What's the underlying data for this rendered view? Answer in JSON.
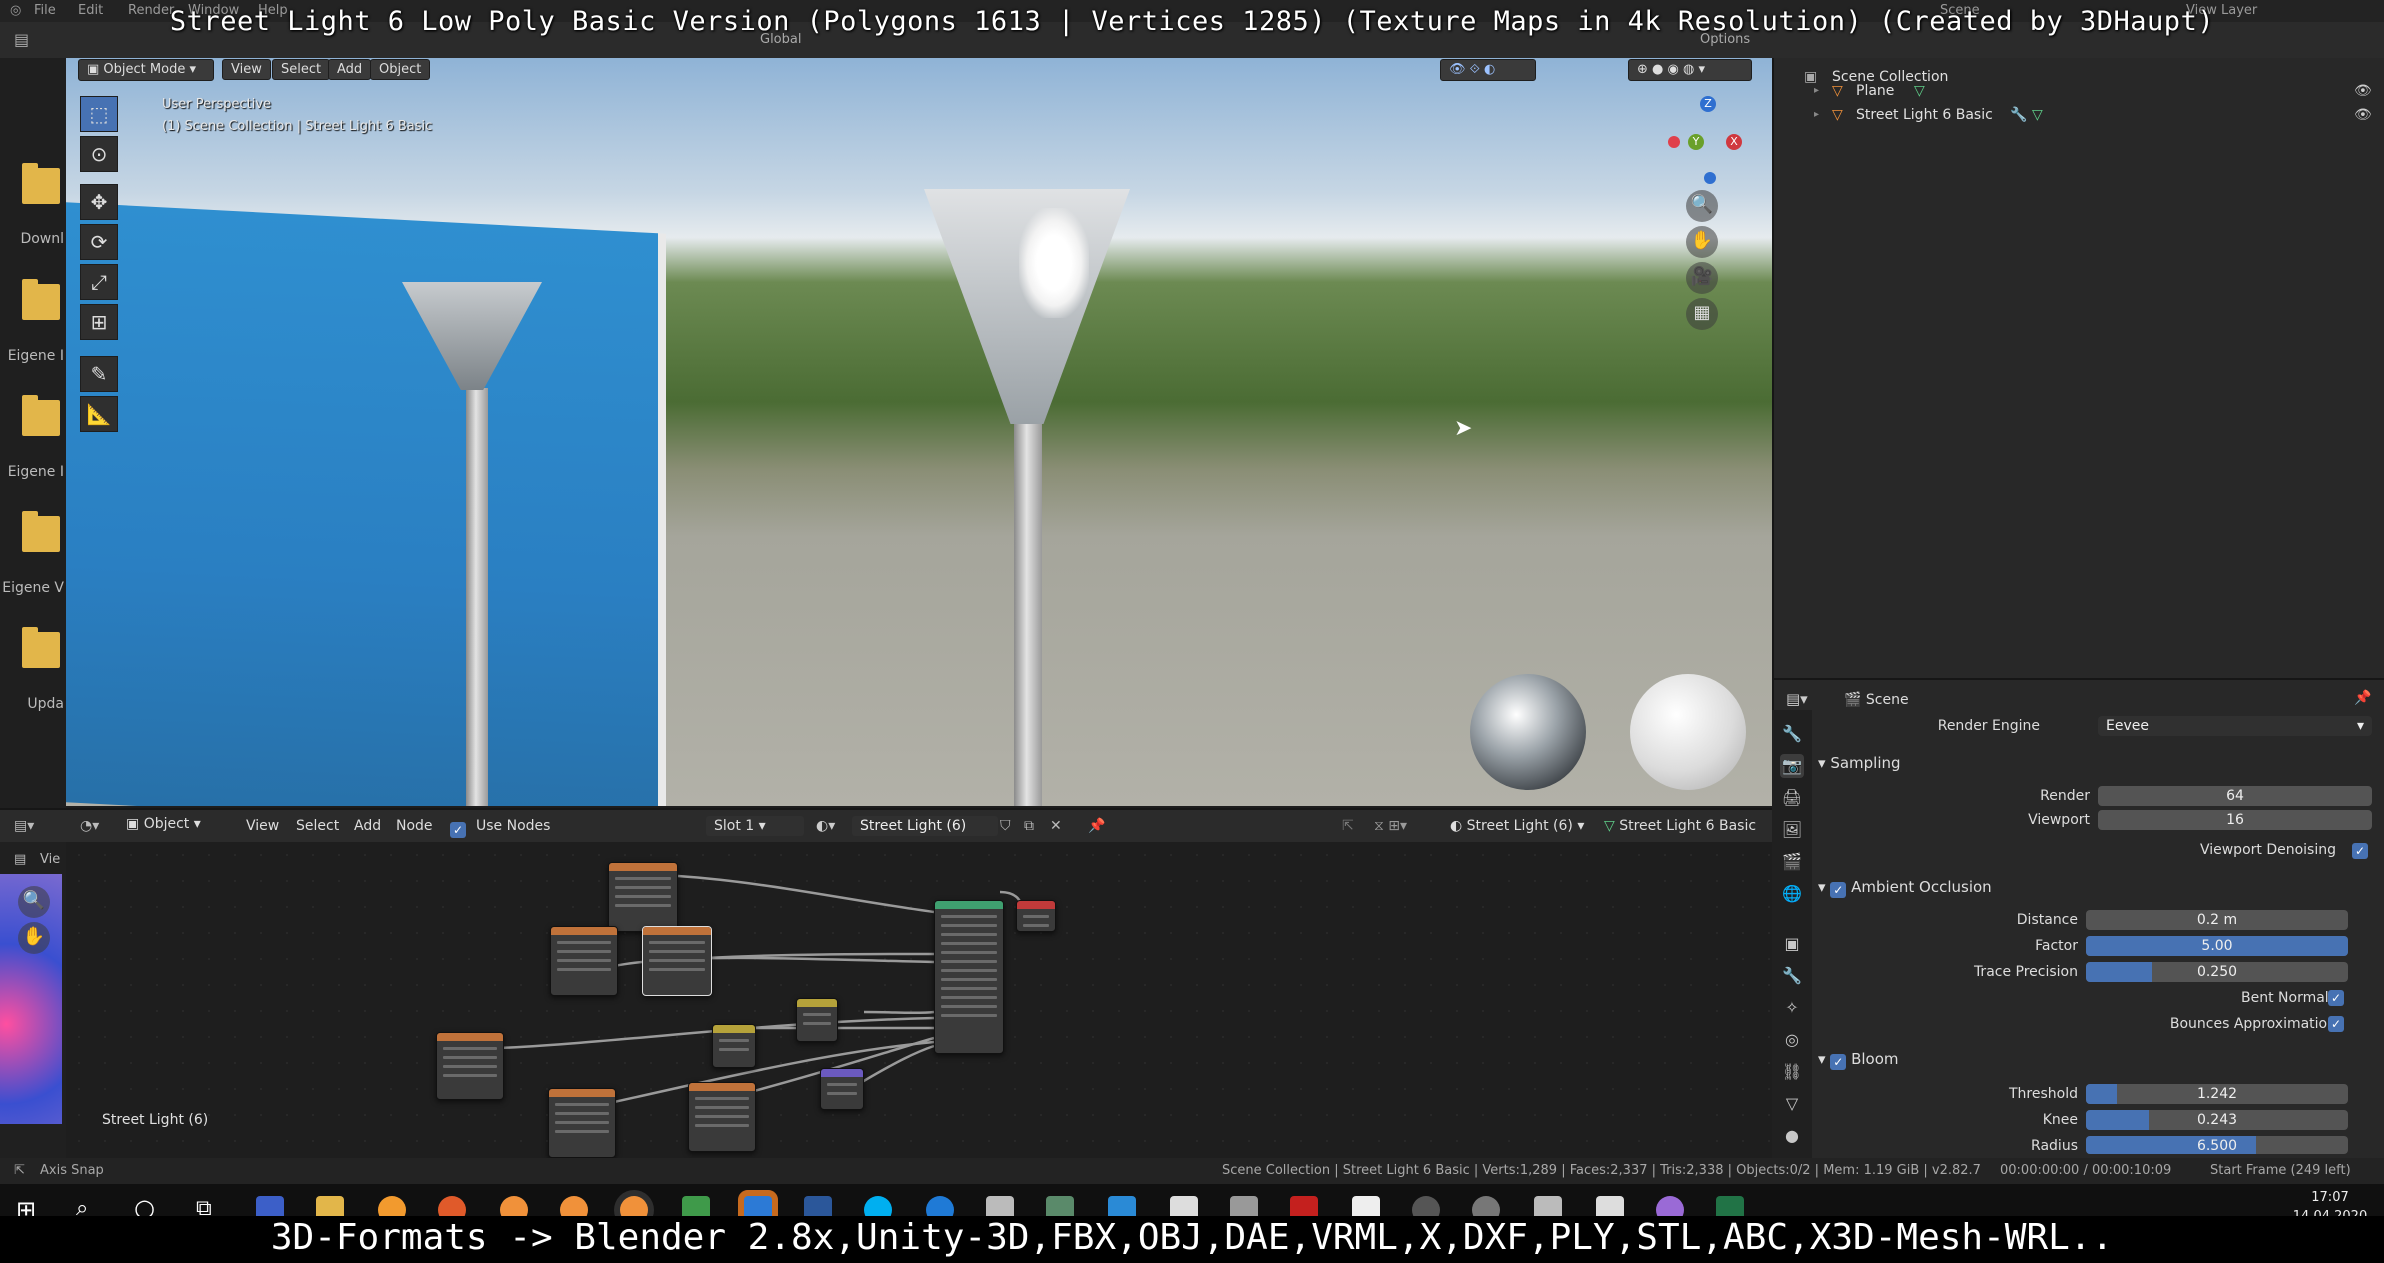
{
  "overlay_title": "Street Light 6 Low Poly Basic Version (Polygons 1613 | Vertices 1285) (Texture Maps in 4k Resolution) (Created by 3DHaupt)",
  "overlay_bottom": "3D-Formats -> Blender 2.8x,Unity-3D,FBX,OBJ,DAE,VRML,X,DXF,PLY,STL,ABC,X3D-Mesh-WRL..",
  "menu": {
    "file": "File",
    "edit": "Edit",
    "render": "Render",
    "window": "Window",
    "help": "Help",
    "scene": "Scene",
    "view_layer": "View Layer"
  },
  "header": {
    "mode": "Object Mode",
    "view": "View",
    "select": "Select",
    "add": "Add",
    "object": "Object",
    "orientation": "Global",
    "options": "Options"
  },
  "viewport_info": {
    "line1": "User Perspective",
    "line2": "(1) Scene Collection | Street Light 6 Basic"
  },
  "gizmo": {
    "x": "X",
    "y": "Y",
    "z": "Z"
  },
  "desktop": [
    {
      "label": "Downl"
    },
    {
      "label": "Eigene I"
    },
    {
      "label": "Eigene I"
    },
    {
      "label": "Eigene V"
    },
    {
      "label": "Upda"
    }
  ],
  "outliner": {
    "title": "Scene Collection",
    "items": [
      {
        "name": "Plane"
      },
      {
        "name": "Street Light 6 Basic"
      }
    ]
  },
  "properties": {
    "title": "Scene",
    "render_engine_label": "Render Engine",
    "render_engine": "Eevee",
    "sampling": {
      "title": "Sampling",
      "render_label": "Render",
      "render": "64",
      "viewport_label": "Viewport",
      "viewport": "16",
      "denoise_label": "Viewport Denoising"
    },
    "ao": {
      "title": "Ambient Occlusion",
      "distance_label": "Distance",
      "distance": "0.2 m",
      "factor_label": "Factor",
      "factor": "5.00",
      "factor_fraction": 1.0,
      "trace_label": "Trace Precision",
      "trace": "0.250",
      "trace_fraction": 0.25,
      "bent_label": "Bent Normals",
      "bounces_label": "Bounces Approximation"
    },
    "bloom": {
      "title": "Bloom",
      "threshold_label": "Threshold",
      "threshold": "1.242",
      "threshold_fraction": 0.12,
      "knee_label": "Knee",
      "knee": "0.243",
      "knee_fraction": 0.24,
      "radius_label": "Radius",
      "radius": "6.500",
      "radius_fraction": 0.65
    }
  },
  "node_header": {
    "object": "Object",
    "view": "View",
    "select": "Select",
    "add": "Add",
    "node": "Node",
    "use_nodes": "Use Nodes",
    "slot": "Slot 1",
    "material": "Street Light (6)",
    "material_right": "Street Light (6)",
    "object_name": "Street Light 6 Basic"
  },
  "node_editor_label": "Street Light (6)",
  "node_side_label": "Vie",
  "status": {
    "left": "Axis Snap",
    "right": "Scene Collection | Street Light 6 Basic | Verts:1,289 | Faces:2,337 | Tris:2,338 | Objects:0/2 | Mem: 1.19 GiB | v2.82.7",
    "time": "00:00:00:00 / 00:00:10:09",
    "frame": "Start Frame (249 left)"
  },
  "clock": {
    "time": "17:07",
    "date": "14.04.2020"
  },
  "colors": {
    "accent": "#4772b3",
    "folder": "#e2b64a",
    "header": "#2b2b2b",
    "panel": "#282828"
  }
}
